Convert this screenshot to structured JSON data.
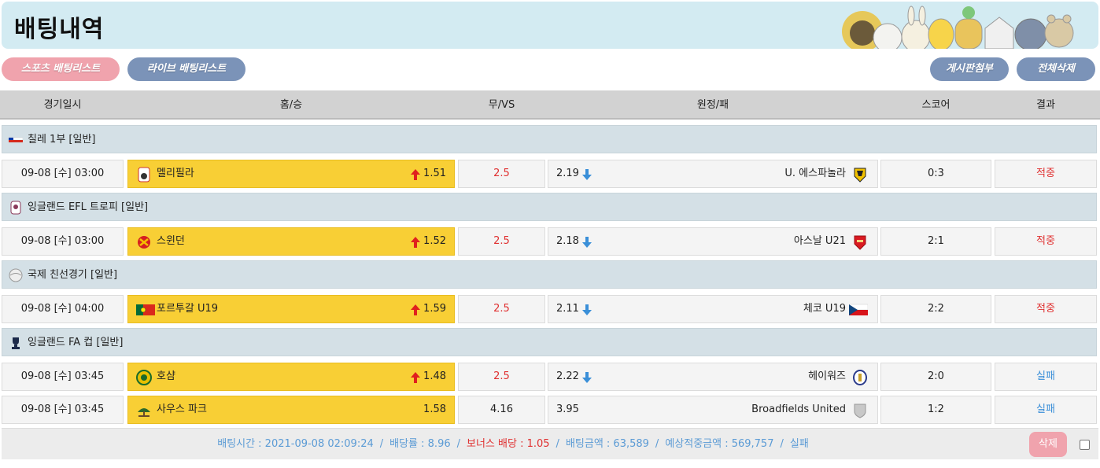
{
  "header": {
    "title": "배팅내역"
  },
  "buttons": {
    "sports_list": "스포츠 배팅리스트",
    "live_list": "라이브 배팅리스트",
    "board_attach": "게시판첨부",
    "delete_all": "전체삭제"
  },
  "columns": {
    "date": "경기일시",
    "home": "홈/승",
    "draw": "무/VS",
    "away": "원정/패",
    "score": "스코어",
    "result": "결과"
  },
  "leagues": [
    {
      "name": "칠레 1부 [일반]",
      "icon": "chile-flag-icon"
    },
    {
      "name": "잉글랜드 EFL 트로피 [일반]",
      "icon": "efl-trophy-icon"
    },
    {
      "name": "국제 친선경기 [일반]",
      "icon": "international-icon"
    },
    {
      "name": "잉글랜드 FA 컵 [일반]",
      "icon": "fa-cup-icon"
    }
  ],
  "matches": [
    {
      "date": "09-08 [수] 03:00",
      "home": "멜리필라",
      "home_odd": "1.51",
      "draw": "2.5",
      "away_odd": "2.19",
      "away": "U. 에스파놀라",
      "score": "0:3",
      "result": "적중"
    },
    {
      "date": "09-08 [수] 03:00",
      "home": "스윈던",
      "home_odd": "1.52",
      "draw": "2.5",
      "away_odd": "2.18",
      "away": "아스날 U21",
      "score": "2:1",
      "result": "적중"
    },
    {
      "date": "09-08 [수] 04:00",
      "home": "포르투갈 U19",
      "home_odd": "1.59",
      "draw": "2.5",
      "away_odd": "2.11",
      "away": "체코 U19",
      "score": "2:2",
      "result": "적중"
    },
    {
      "date": "09-08 [수] 03:45",
      "home": "호샴",
      "home_odd": "1.48",
      "draw": "2.5",
      "away_odd": "2.22",
      "away": "헤이워즈",
      "score": "2:0",
      "result": "실패"
    },
    {
      "date": "09-08 [수] 03:45",
      "home": "사우스 파크",
      "home_odd": "1.58",
      "draw": "4.16",
      "away_odd": "3.95",
      "away": "Broadfields United",
      "score": "1:2",
      "result": "실패"
    }
  ],
  "summary": {
    "bet_time": "배팅시간 : 2021-09-08 02:09:24",
    "odds": "배당률 : 8.96",
    "bonus": "보너스 배당 : 1.05",
    "amount": "배팅금액 : 63,589",
    "expected": "예상적중금액 : 569,757",
    "status": "실패",
    "separator": "/"
  },
  "footer": {
    "delete_label": "삭제"
  },
  "colors": {
    "banner": "#d3ebf2",
    "selected_pick": "#f8cf35",
    "win": "#e03030",
    "lose": "#3a8fd8",
    "pill_pink": "#f0a3ad",
    "pill_blue": "#7b93b8"
  }
}
